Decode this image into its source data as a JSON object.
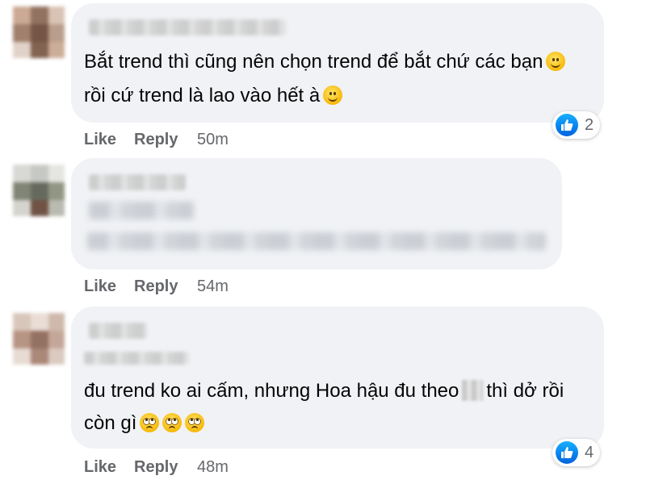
{
  "comments": [
    {
      "text_line1": "Bắt trend thì cũng nên chọn trend để bắt chứ các bạn",
      "text_line2": "rồi cứ trend là lao vào hết à",
      "reaction_count": "2",
      "actions": {
        "like": "Like",
        "reply": "Reply",
        "time": "50m"
      }
    },
    {
      "actions": {
        "like": "Like",
        "reply": "Reply",
        "time": "54m"
      }
    },
    {
      "text_line1": "đu trend ko ai cấm, nhưng Hoa hậu đu theo",
      "text_line1_suffix": "thì dở rồi",
      "text_line2": "còn gì",
      "reaction_count": "4",
      "actions": {
        "like": "Like",
        "reply": "Reply",
        "time": "48m"
      }
    }
  ],
  "icons": {
    "emoji_smile": "slightly-smiling-face-icon",
    "emoji_eyeroll": "face-with-rolling-eyes-icon",
    "reaction": "like-reaction-icon"
  },
  "colors": {
    "bubble": "#f0f2f5",
    "action_text": "#65676b",
    "like_blue": "#0866ff"
  }
}
